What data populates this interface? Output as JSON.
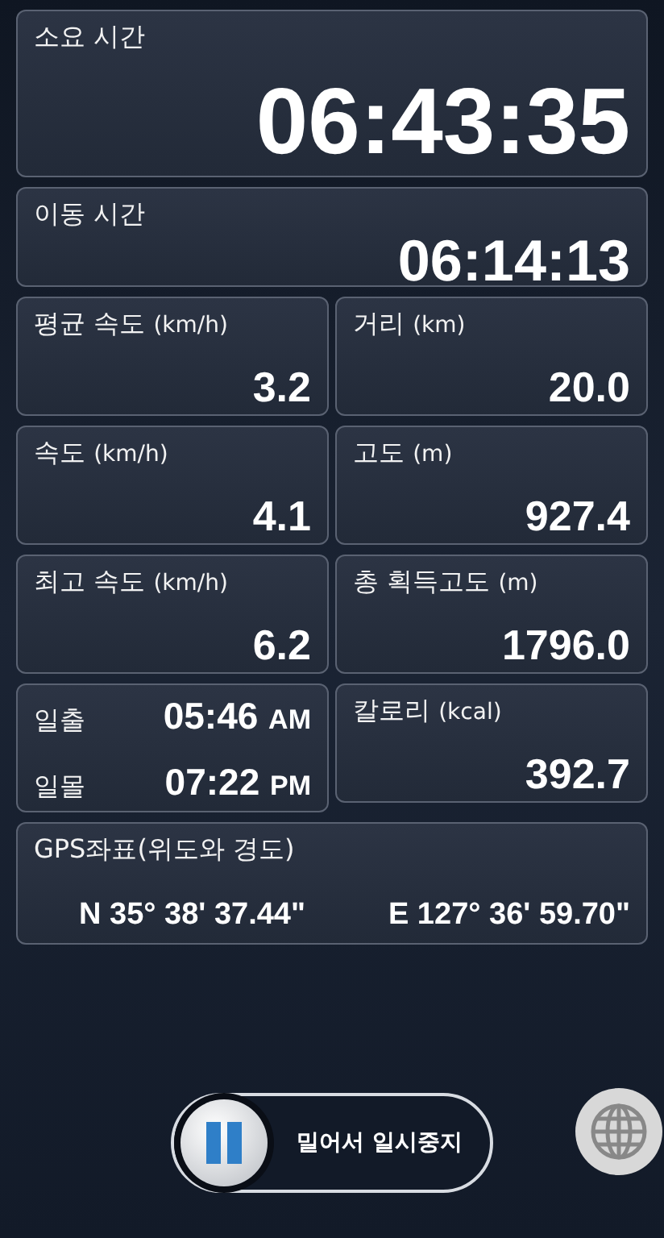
{
  "elapsed": {
    "label": "소요 시간",
    "value": "06:43:35"
  },
  "moving": {
    "label": "이동 시간",
    "value": "06:14:13"
  },
  "stats": [
    {
      "label": "평균 속도",
      "unit": "(km/h)",
      "value": "3.2"
    },
    {
      "label": "거리",
      "unit": "(km)",
      "value": "20.0"
    },
    {
      "label": "속도",
      "unit": "(km/h)",
      "value": "4.1"
    },
    {
      "label": "고도",
      "unit": "(m)",
      "value": "927.4"
    },
    {
      "label": "최고 속도",
      "unit": "(km/h)",
      "value": "6.2"
    },
    {
      "label": "총 획득고도",
      "unit": "(m)",
      "value": "1796.0"
    }
  ],
  "sun": [
    {
      "label": "일출",
      "time": "05:46",
      "period": "AM"
    },
    {
      "label": "일몰",
      "time": "07:22",
      "period": "PM"
    }
  ],
  "calories": {
    "label": "칼로리",
    "unit": "(kcal)",
    "value": "392.7"
  },
  "gps": {
    "label": "GPS좌표(위도와 경도)",
    "latitude": "N 35° 38' 37.44\"",
    "longitude": "E 127° 36' 59.70\""
  },
  "pause": {
    "label": "밀어서 일시중지",
    "level": 0
  }
}
